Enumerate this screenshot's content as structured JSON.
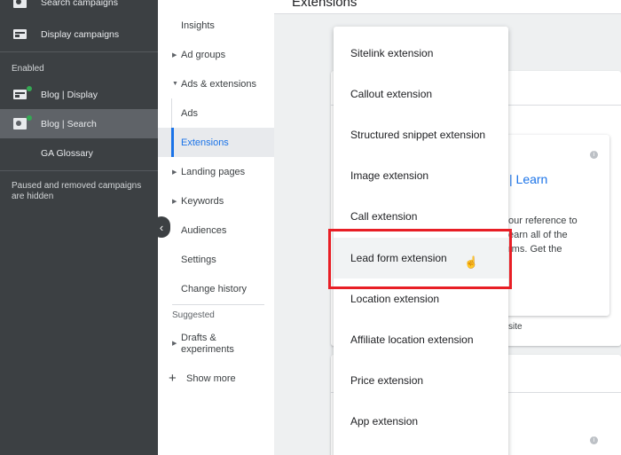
{
  "campaigns": {
    "search_campaigns": "Search campaigns",
    "display_campaigns": "Display campaigns",
    "enabled_label": "Enabled",
    "blog_display": "Blog | Display",
    "blog_search": "Blog | Search",
    "ga_glossary": "GA Glossary",
    "hidden_note": "Paused and removed campaigns are hidden"
  },
  "nav": {
    "insights": "Insights",
    "ad_groups": "Ad groups",
    "ads_extensions": "Ads & extensions",
    "ads": "Ads",
    "extensions": "Extensions",
    "landing_pages": "Landing pages",
    "keywords": "Keywords",
    "audiences": "Audiences",
    "settings": "Settings",
    "change_history": "Change history",
    "suggested": "Suggested",
    "drafts_line1": "Drafts &",
    "drafts_line2": "experiments",
    "show_more": "Show more"
  },
  "main": {
    "title": "Extensions",
    "learn": "| Learn",
    "card_lines": [
      "our reference to",
      "earn all of the",
      "rms. Get the"
    ],
    "site": "site"
  },
  "menu": {
    "items": [
      "Sitelink extension",
      "Callout extension",
      "Structured snippet extension",
      "Image extension",
      "Call extension",
      "Lead form extension",
      "Location extension",
      "Affiliate location extension",
      "Price extension",
      "App extension"
    ],
    "highlighted_index": 5
  },
  "colors": {
    "sidebar_bg": "#3c4043",
    "accent": "#1a73e8",
    "highlight_border": "#e81e25"
  }
}
